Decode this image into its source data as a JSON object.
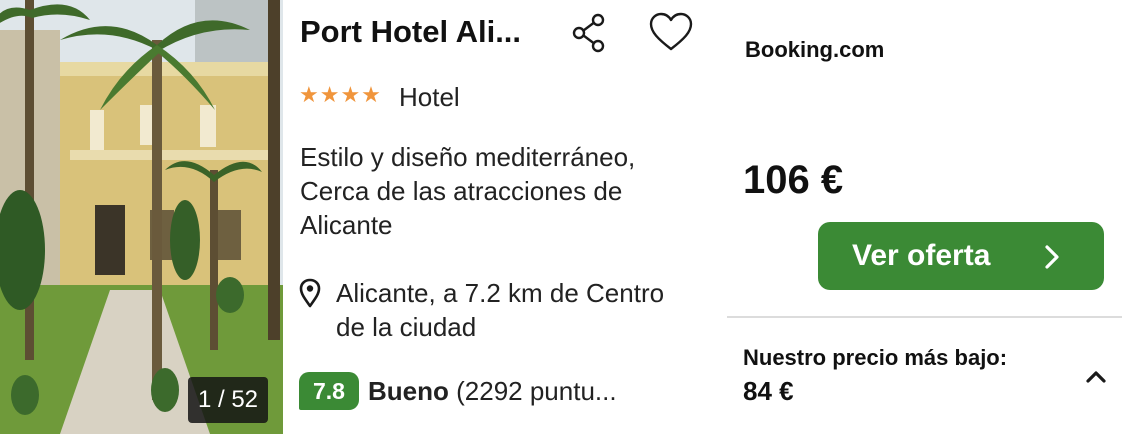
{
  "photo": {
    "counter": "1 / 52"
  },
  "hotel": {
    "name": "Port Hotel Ali...",
    "stars_glyph": "★★★★",
    "star_count": 4,
    "type": "Hotel",
    "description": "Estilo y diseño mediterráneo, Cerca de las atracciones de Alicante",
    "location": "Alicante, a 7.2 km de Centro de la ciudad"
  },
  "rating": {
    "score": "7.8",
    "word": "Bueno",
    "reviews": " (2292 puntu..."
  },
  "offer": {
    "provider": "Booking.com",
    "price": "106 €",
    "button_label": "Ver oferta"
  },
  "lowest": {
    "label": "Nuestro precio más bajo:",
    "price": "84 €"
  },
  "icons": {
    "share": "share-icon",
    "favorite": "heart-icon",
    "location": "map-pin-icon",
    "chevron_right": "chevron-right-icon",
    "chevron_up": "chevron-up-icon"
  },
  "colors": {
    "accent_green": "#3b8a35",
    "star_orange": "#f0953c"
  }
}
